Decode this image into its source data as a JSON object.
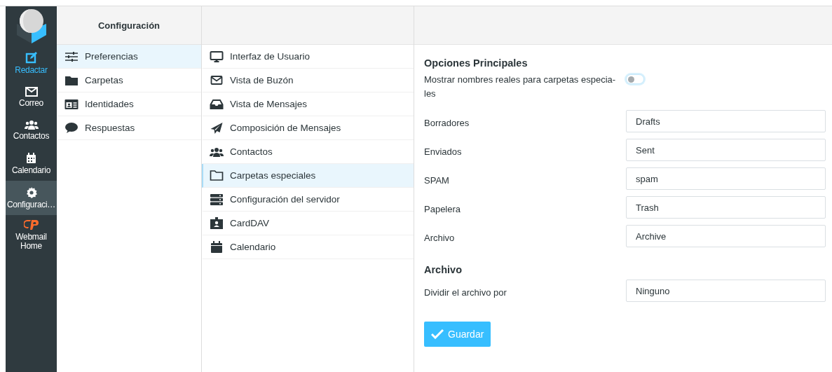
{
  "nav": [
    {
      "label": "Redactar",
      "kind": "action",
      "selected": false
    },
    {
      "label": "Correo",
      "kind": "nav",
      "selected": false
    },
    {
      "label": "Contactos",
      "kind": "nav",
      "selected": false
    },
    {
      "label": "Calendario",
      "kind": "nav",
      "selected": false
    },
    {
      "label": "Configuraci…",
      "kind": "nav",
      "selected": true
    },
    {
      "label": "Webmail Home",
      "kind": "link",
      "selected": false
    }
  ],
  "settings_panel": {
    "title": "Configuración",
    "items": [
      {
        "label": "Preferencias",
        "selected": true
      },
      {
        "label": "Carpetas",
        "selected": false
      },
      {
        "label": "Identidades",
        "selected": false
      },
      {
        "label": "Respuestas",
        "selected": false
      }
    ]
  },
  "sections_panel": {
    "items": [
      {
        "label": "Interfaz de Usuario",
        "selected": false
      },
      {
        "label": "Vista de Buzón",
        "selected": false
      },
      {
        "label": "Vista de Mensajes",
        "selected": false
      },
      {
        "label": "Composición de Mensajes",
        "selected": false
      },
      {
        "label": "Contactos",
        "selected": false
      },
      {
        "label": "Carpetas especiales",
        "selected": true
      },
      {
        "label": "Configuración del servidor",
        "selected": false
      },
      {
        "label": "CardDAV",
        "selected": false
      },
      {
        "label": "Calendario",
        "selected": false
      }
    ]
  },
  "form": {
    "sections": [
      {
        "title": "Opciones Principales",
        "rows": [
          {
            "kind": "toggle",
            "label": "Mostrar nombres reales para carpetas especia-les",
            "on": false
          },
          {
            "kind": "field",
            "label": "Borradores",
            "value": "Drafts"
          },
          {
            "kind": "field",
            "label": "Enviados",
            "value": "Sent"
          },
          {
            "kind": "field",
            "label": "SPAM",
            "value": "spam"
          },
          {
            "kind": "field",
            "label": "Papelera",
            "value": "Trash"
          },
          {
            "kind": "field",
            "label": "Archivo",
            "value": "Archive"
          }
        ]
      },
      {
        "title": "Archivo",
        "rows": [
          {
            "kind": "field",
            "label": "Dividir el archivo por",
            "value": "Ninguno"
          }
        ]
      }
    ],
    "save_button": "Guardar"
  }
}
